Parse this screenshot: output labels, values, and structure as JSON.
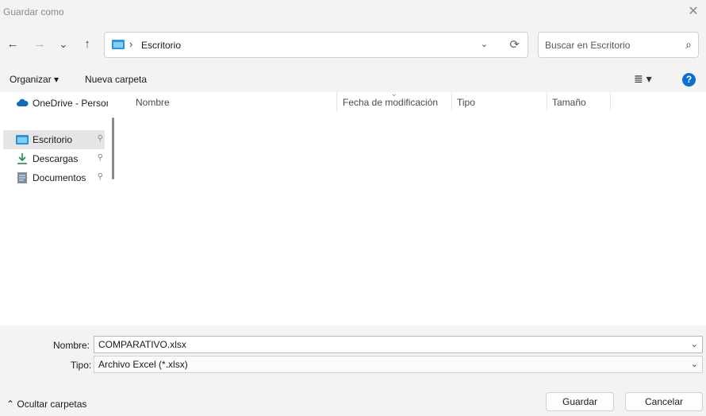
{
  "window": {
    "title": "Guardar como",
    "close_glyph": "✕"
  },
  "nav_buttons": {
    "back": "←",
    "forward": "→",
    "recent": "⌄",
    "up": "↑"
  },
  "address": {
    "separator": "›",
    "crumb": "Escritorio",
    "dropdown": "⌄",
    "refresh": "⟳"
  },
  "search": {
    "placeholder": "Buscar en Escritorio",
    "icon": "⌕"
  },
  "toolbar": {
    "organize_label": "Organizar ▾",
    "new_folder_label": "Nueva carpeta",
    "view_glyph": "≣ ▾",
    "help_glyph": "?"
  },
  "sidebar": {
    "items": [
      {
        "label": "OneDrive - Person",
        "icon": "cloud-icon"
      },
      {
        "label": "Escritorio",
        "icon": "desktop-folder-icon",
        "pin": "📌"
      },
      {
        "label": "Descargas",
        "icon": "download-icon",
        "pin": "📌"
      },
      {
        "label": "Documentos",
        "icon": "documents-icon",
        "pin": "📌"
      }
    ]
  },
  "columns": {
    "name": "Nombre",
    "modified": "Fecha de modificación",
    "type": "Tipo",
    "size": "Tamaño",
    "sort_glyph": "⌄"
  },
  "form": {
    "filename_label": "Nombre:",
    "filename_value": "COMPARATIVO.xlsx",
    "type_label": "Tipo:",
    "type_value": "Archivo Excel (*.xlsx)",
    "dropdown": "⌄"
  },
  "footer": {
    "hide_folders": "⌃  Ocultar carpetas",
    "save_label": "Guardar",
    "cancel_label": "Cancelar"
  },
  "colors": {
    "accent": "#0a6fd1",
    "folder": "#2a95d8"
  }
}
